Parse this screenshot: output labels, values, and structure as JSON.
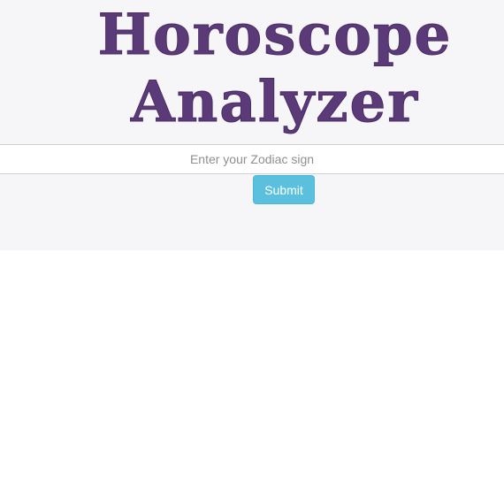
{
  "header": {
    "title_line_1": "Horoscope",
    "title_line_2": "Analyzer"
  },
  "form": {
    "zodiac_placeholder": "Enter your Zodiac sign",
    "zodiac_value": "",
    "submit_label": "Submit"
  },
  "colors": {
    "title": "#5b3a78",
    "header_background": "#f6f6f9",
    "button_background": "#5bc0de"
  }
}
